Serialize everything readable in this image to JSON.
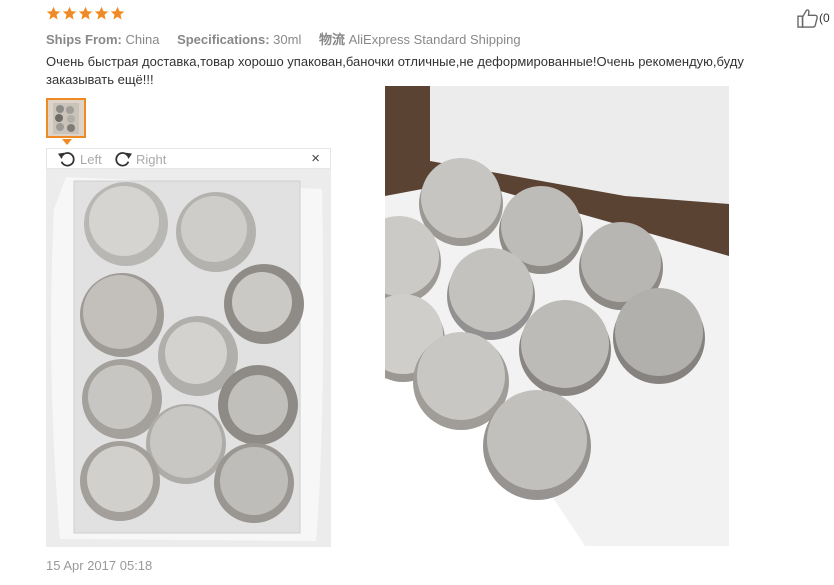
{
  "rating": {
    "stars": 5,
    "color": "#f08a24"
  },
  "meta": {
    "ships_from_label": "Ships From:",
    "ships_from_value": "China",
    "spec_label": "Specifications:",
    "spec_value": "30ml",
    "shipping_label": "物流",
    "shipping_value": "AliExpress Standard Shipping"
  },
  "helpful": {
    "count_text": "(0"
  },
  "review": {
    "text": "Очень быстрая доставка,товар хорошо упакован,баночки отличные,не деформированные!Очень рекомендую,буду заказывать ещё!!!"
  },
  "viewer": {
    "left_label": "Left",
    "right_label": "Right",
    "close_glyph": "×"
  },
  "date": "15 Apr 2017 05:18",
  "colors": {
    "accent": "#f08a24",
    "muted": "#999999"
  }
}
